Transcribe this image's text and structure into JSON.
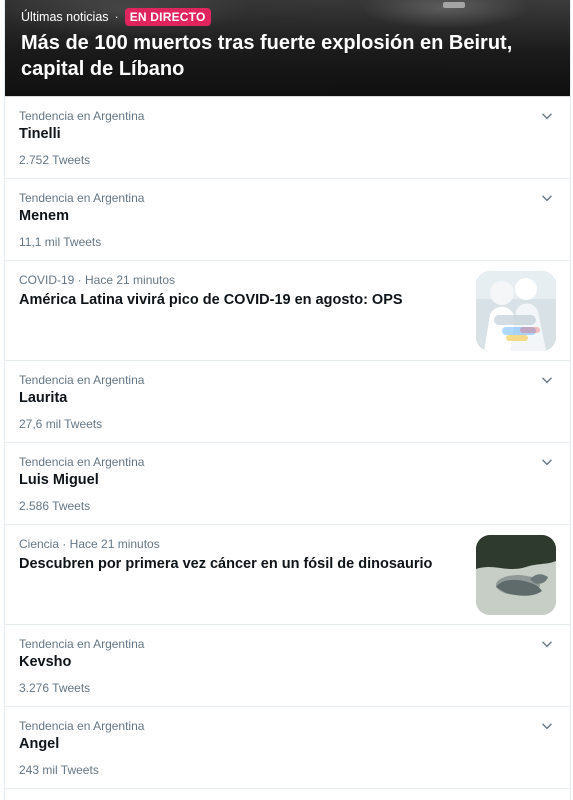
{
  "header": {
    "kicker": "Últimas noticias",
    "separator": "·",
    "badge": "EN DIRECTO",
    "headline": "Más de 100 muertos tras fuerte explosión en Beirut, capital de Líbano"
  },
  "trends": [
    {
      "type": "trend",
      "context": "Tendencia en Argentina",
      "title": "Tinelli",
      "count": "2.752 Tweets"
    },
    {
      "type": "trend",
      "context": "Tendencia en Argentina",
      "title": "Menem",
      "count": "11,1 mil Tweets"
    },
    {
      "type": "news",
      "context": "COVID-19 · Hace 21 minutos",
      "title": "América Latina vivirá pico de COVID-19 en agosto: OPS",
      "thumb": "protective-suit-workers-photo"
    },
    {
      "type": "trend",
      "context": "Tendencia en Argentina",
      "title": "Laurita",
      "count": "27,6 mil Tweets"
    },
    {
      "type": "trend",
      "context": "Tendencia en Argentina",
      "title": "Luis Miguel",
      "count": "2.586 Tweets"
    },
    {
      "type": "news",
      "context": "Ciencia · Hace 21 minutos",
      "title": "Descubren por primera vez cáncer en un fósil de dinosaurio",
      "thumb": "dinosaur-fossil-photo"
    },
    {
      "type": "trend",
      "context": "Tendencia en Argentina",
      "title": "Kevsho",
      "count": "3.276 Tweets"
    },
    {
      "type": "trend",
      "context": "Tendencia en Argentina",
      "title": "Angel",
      "count": "243 mil Tweets"
    }
  ],
  "colors": {
    "accent_live": "#e0245e",
    "muted_text": "#657786",
    "primary_text": "#0f1419",
    "divider": "#e6ecf0"
  },
  "icons": {
    "more": "chevron-down-icon"
  }
}
